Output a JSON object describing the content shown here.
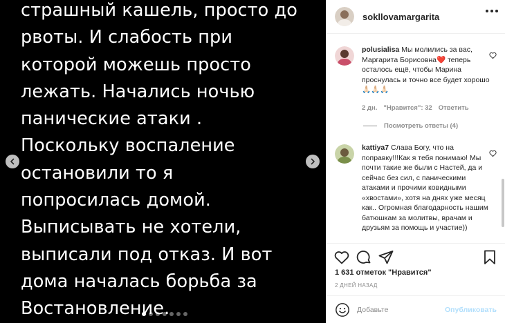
{
  "post": {
    "text": "страшный кашель, просто до\nрвоты. И слабость при\nкоторой можешь просто\nлежать. Начались ночью\nпанические атаки .\nПоскольку воспаление\nостановили то я\nпопросилась домой.\nВыписывать не хотели,\nвыписали под отказ. И вот\nдома началась борьба за\nВостановление.",
    "carousel_dots": 7,
    "active_dot": 0
  },
  "header": {
    "username": "sokllovamargarita"
  },
  "comments": [
    {
      "username": "polusialisa",
      "text": "Мы молились за вас, Маргарита Борисовна❤️ теперь осталось ещё, чтобы Марина проснулась и точно все будет хорошо🙏🏻🙏🏻🙏🏻",
      "time": "2 дн.",
      "likes": "\"Нравится\": 32",
      "reply": "Ответить",
      "view_replies": "Посмотреть ответы (4)"
    },
    {
      "username": "kattiya7",
      "text": "Слава Богу, что на поправку!!!Как я тебя понимаю! Мы почти такие же были с Настей, да и сейчас без сил, с паническими атаками и прочими ковидными «хвостами», хотя на днях уже месяц как.. Огромная благодарность нашим батюшкам за молитвы, врачам и друзьям за помощь и участие))"
    }
  ],
  "actions": {
    "likes_text": "1 631 отметок \"Нравится\"",
    "time_ago": "2 ДНЕЙ НАЗАД"
  },
  "add_comment": {
    "placeholder": "Добавьте комментарий...",
    "display": "Добавьте",
    "publish": "Опубликовать"
  },
  "colors": {
    "link_blue_disabled": "#b2dffc",
    "gray": "#8e8e8e",
    "heart_red": "#ed4956"
  }
}
